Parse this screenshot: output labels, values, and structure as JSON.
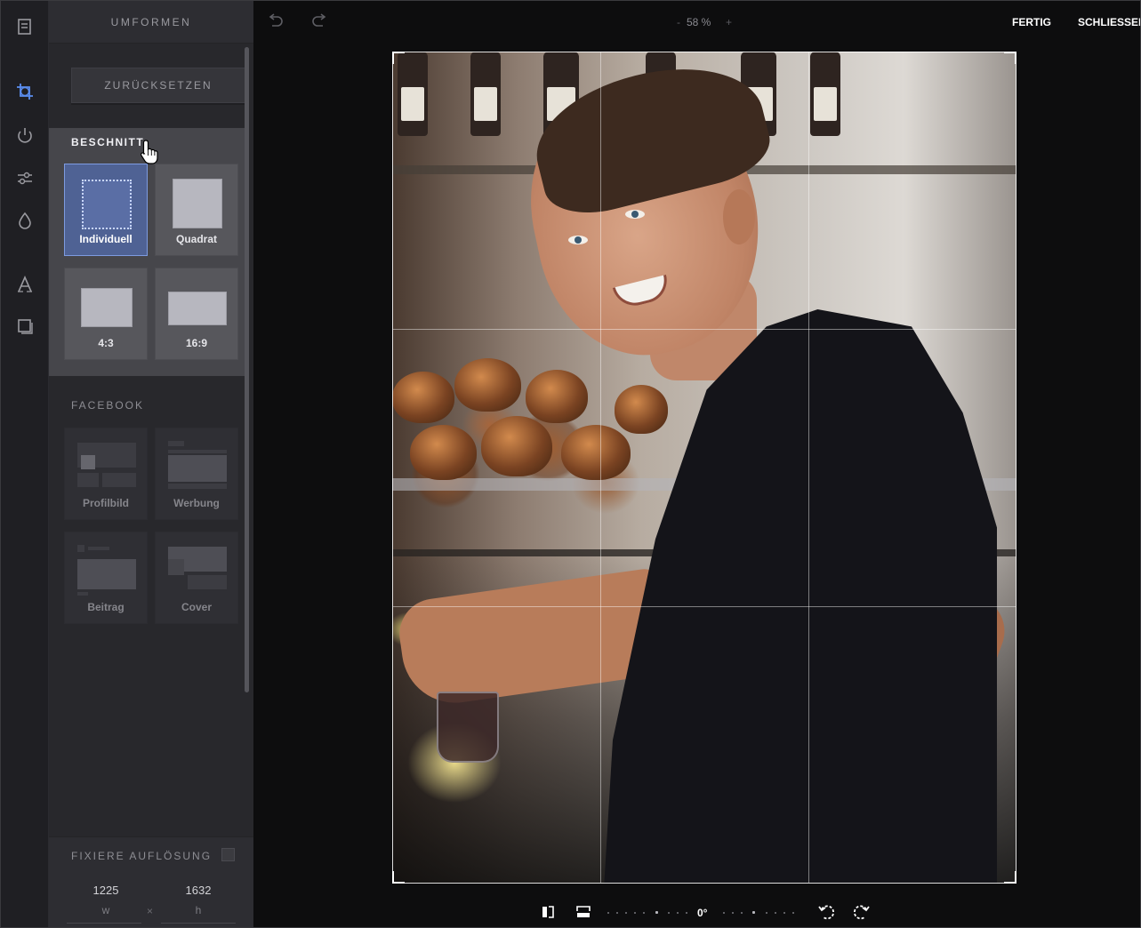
{
  "rail": {
    "icons": [
      "document-icon",
      "crop-icon",
      "filter-icon",
      "adjust-icon",
      "drop-icon",
      "text-icon",
      "frame-icon"
    ]
  },
  "panel": {
    "title": "UMFORMEN",
    "reset_label": "ZURÜCKSETZEN",
    "crop": {
      "title": "BESCHNITT",
      "options": [
        {
          "label": "Individuell",
          "active": true
        },
        {
          "label": "Quadrat",
          "active": false
        },
        {
          "label": "4:3",
          "active": false
        },
        {
          "label": "16:9",
          "active": false
        }
      ]
    },
    "facebook": {
      "title": "FACEBOOK",
      "options": [
        {
          "label": "Profilbild"
        },
        {
          "label": "Werbung"
        },
        {
          "label": "Beitrag"
        },
        {
          "label": "Cover"
        }
      ]
    },
    "fixed_resolution": {
      "title": "FIXIERE AUFLÖSUNG",
      "checked": false,
      "width_value": "1225",
      "width_label": "w",
      "separator": "×",
      "height_value": "1632",
      "height_label": "h"
    }
  },
  "toolbar": {
    "zoom_minus": "-",
    "zoom_level": "58 %",
    "zoom_plus": "+",
    "done_label": "FERTIG",
    "close_label": "SCHLIESSEN"
  },
  "bottom": {
    "rotation_value": "0°"
  },
  "colors": {
    "accent_blue": "#4f6294",
    "active_border": "#7d9be0",
    "rail_active_icon": "#5b8ef0"
  }
}
